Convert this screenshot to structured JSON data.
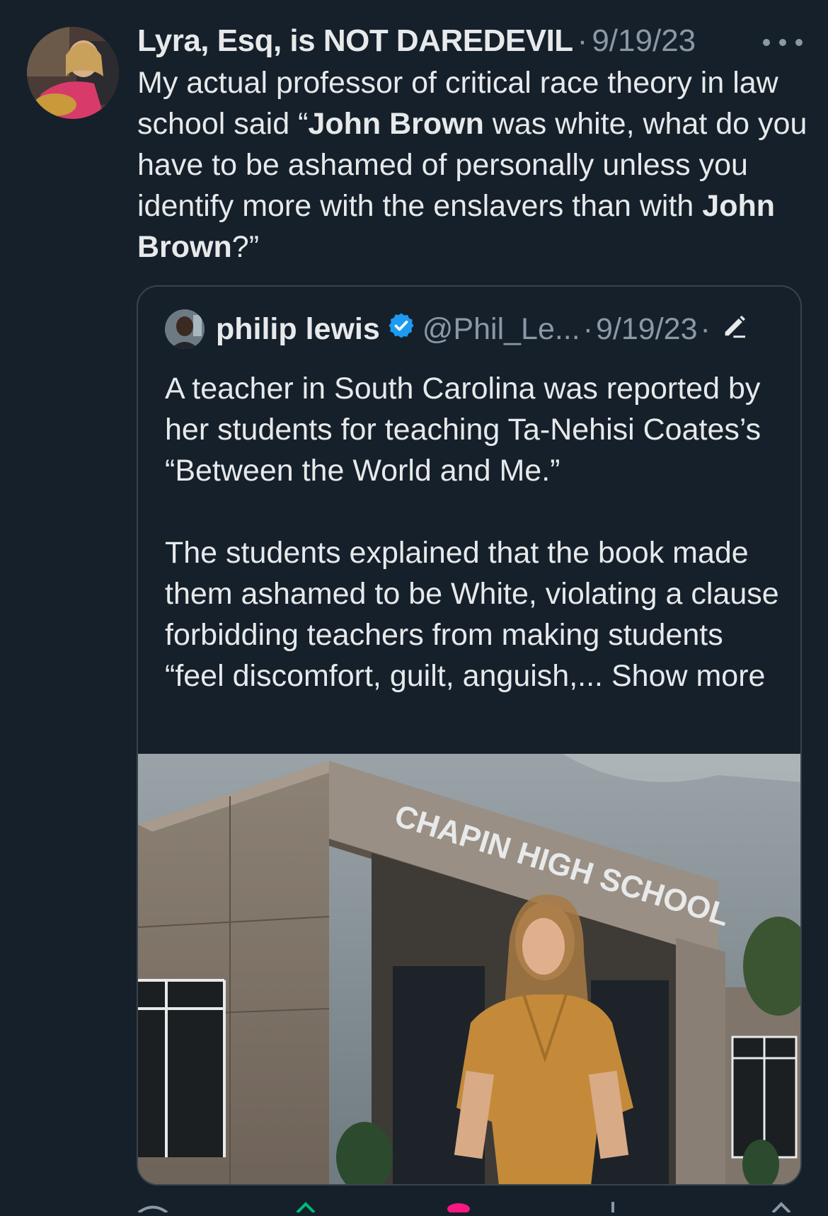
{
  "tweet": {
    "author_name": "Lyra, Esq, is NOT DAREDEVIL",
    "separator": "·",
    "date": "9/19/23",
    "more_icon": "ellipsis-icon",
    "text_part1": "My actual professor of critical race theory in law school said “",
    "bold1": "John Brown",
    "text_part2": " was white, what do you have to be ashamed of personally unless you identify more with the enslavers than with ",
    "bold2": "John Brown",
    "text_part3": "?”"
  },
  "quoted": {
    "name": "philip lewis",
    "verified_icon": "verified-badge-icon",
    "handle": "@Phil_Le...",
    "separator": "·",
    "date": "9/19/23",
    "separator2": "·",
    "edit_icon": "edited-pencil-icon",
    "paragraph1": "A teacher in South Carolina was reported by her students for teaching Ta-Nehisi Coates’s “Between the World and Me.”",
    "paragraph2": "The students explained that the book made them ashamed to be White, violating a clause forbidding teachers from making students “feel discomfort, guilt, anguish,...",
    "show_more": "Show more",
    "image_sign_text": "CHAPIN HIGH SCHOOL"
  },
  "colors": {
    "background": "#15202b",
    "text": "#e7e9ea",
    "muted": "#8b98a5",
    "verified": "#1d9bf0",
    "border": "#38444d"
  }
}
